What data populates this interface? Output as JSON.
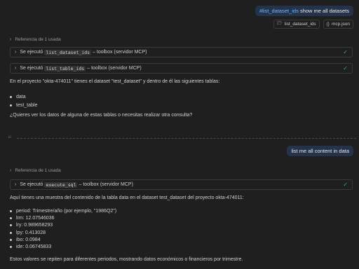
{
  "turn1": {
    "user_hashtag": "#list_dataset_ids",
    "user_text": "show me all datasets",
    "attachments": [
      {
        "icon": "🗁",
        "label": "list_dataset_ids"
      },
      {
        "icon": "{}",
        "label": "mcp.json"
      }
    ],
    "reference_label": "Referencia de 1 usada",
    "tools": [
      {
        "prefix": "Se ejecutó",
        "tool": "list_dataset_ids",
        "suffix": "– toolbox (servidor MCP)"
      },
      {
        "prefix": "Se ejecutó",
        "tool": "list_table_ids",
        "suffix": "– toolbox (servidor MCP)"
      }
    ],
    "answer_intro": "En el proyecto \"okta-474011\" tienes el dataset \"test_dataset\" y dentro de él las siguientes tablas:",
    "tables": [
      "data",
      "test_table"
    ],
    "answer_question": "¿Quieres ver los datos de alguna de estas tablas o necesitas realizar otra consulta?"
  },
  "turn2": {
    "user_text": "list me all content in data",
    "reference_label": "Referencia de 1 usada",
    "tool": {
      "prefix": "Se ejecutó",
      "tool": "execute_sql",
      "suffix": "– toolbox (servidor MCP)"
    },
    "answer_intro": "Aquí tienes una muestra del contenido de la tabla data en el dataset test_dataset del proyecto okta-474011:",
    "rows": [
      "period: Trimestre/año (por ejemplo, \"1986Q2\")",
      "lrm: 12.07546036",
      "lry: 0.989658293",
      "lpy: 0.413028",
      "ibo: 0.0984",
      "ide: 0.06745833"
    ],
    "answer_footer": "Estos valores se repiten para diferentes periodos, mostrando datos económicos o financieros por trimestre."
  },
  "colors": {
    "background": "#1f1f1f",
    "user_bubble": "#25334a",
    "hashtag": "#6cb6ff",
    "check": "#3fb950"
  }
}
